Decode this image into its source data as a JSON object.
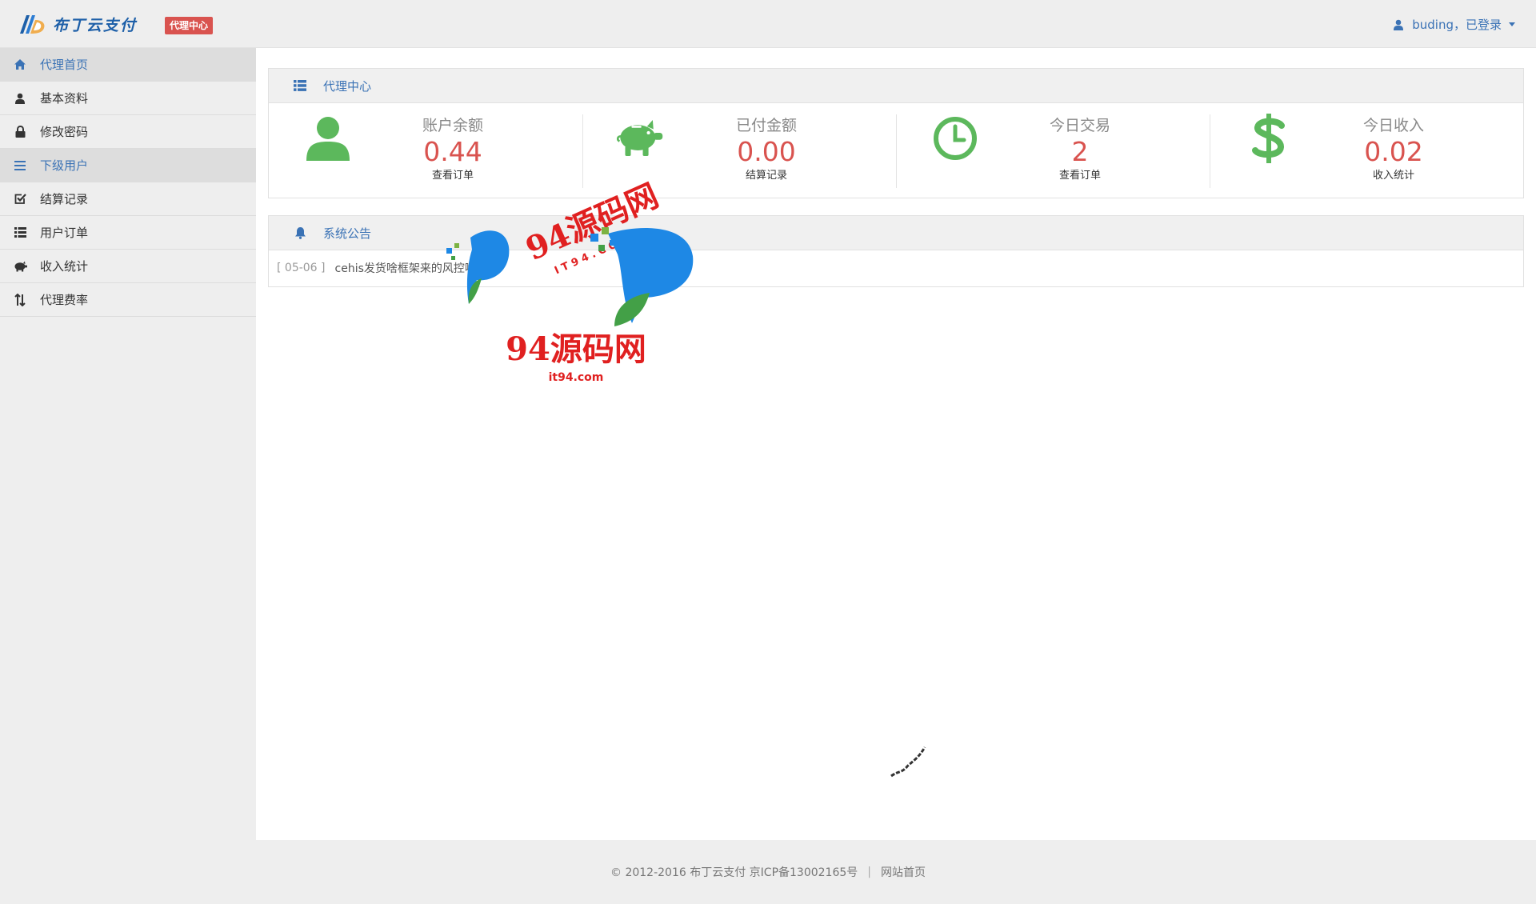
{
  "header": {
    "brand": "布丁云支付",
    "badge": "代理中心",
    "username": "buding",
    "login_status": "，已登录"
  },
  "sidebar": {
    "items": [
      {
        "label": "代理首页",
        "icon": "home-icon"
      },
      {
        "label": "基本资料",
        "icon": "user-icon"
      },
      {
        "label": "修改密码",
        "icon": "lock-icon"
      },
      {
        "label": "下级用户",
        "icon": "list-icon"
      },
      {
        "label": "结算记录",
        "icon": "check-square-icon"
      },
      {
        "label": "用户订单",
        "icon": "th-list-icon"
      },
      {
        "label": "收入统计",
        "icon": "piggy-bank-icon"
      },
      {
        "label": "代理费率",
        "icon": "sort-icon"
      }
    ]
  },
  "agent_panel": {
    "title": "代理中心",
    "stats": [
      {
        "label": "账户余额",
        "value": "0.44",
        "link": "查看订单",
        "icon": "user-icon"
      },
      {
        "label": "已付金额",
        "value": "0.00",
        "link": "结算记录",
        "icon": "piggy-bank-icon"
      },
      {
        "label": "今日交易",
        "value": "2",
        "link": "查看订单",
        "icon": "clock-icon"
      },
      {
        "label": "今日收入",
        "value": "0.02",
        "link": "收入统计",
        "icon": "dollar-icon"
      }
    ]
  },
  "notice_panel": {
    "title": "系统公告",
    "items": [
      {
        "date": "[ 05-06 ]",
        "title": "cehis发货啥框架来的风控啥"
      }
    ]
  },
  "watermark": {
    "text_top": "94源码网",
    "text_sub": "I T 9 4 . C O M",
    "text_main": "94源码网",
    "text_url": "it94.com"
  },
  "footer": {
    "copyright": "© 2012-2016  布丁云支付  京ICP备13002165号",
    "separator": "|",
    "link": "网站首页"
  },
  "colors": {
    "accent": "#3a72b5",
    "badge": "#d9534f",
    "value": "#d9534f",
    "stat_icon": "#5cb85c"
  }
}
